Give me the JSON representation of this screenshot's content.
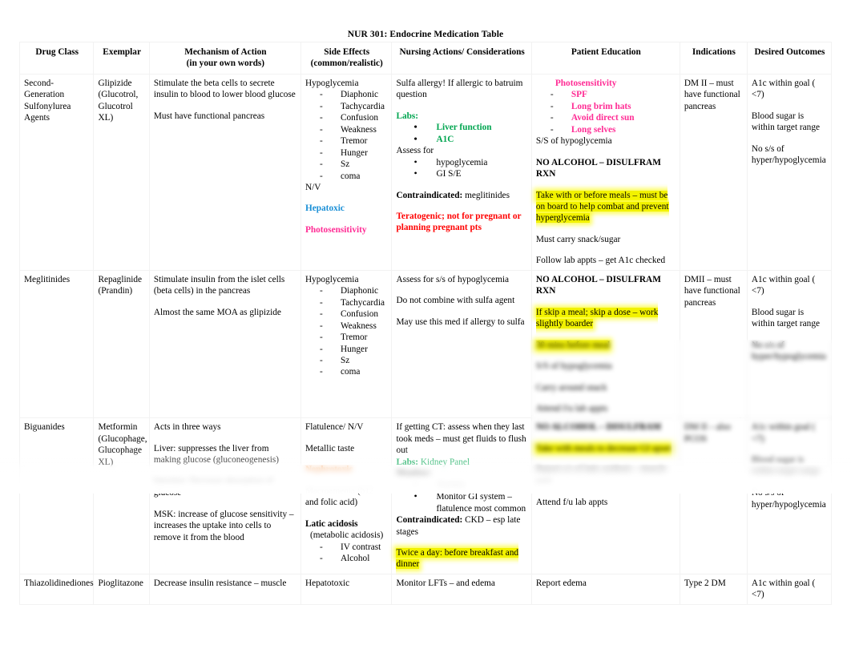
{
  "document": {
    "title": "NUR 301: Endocrine Medication Table"
  },
  "colors": {
    "green": "#00a550",
    "pink": "#ff2d95",
    "blue": "#1a8fd6",
    "red": "#ff0000",
    "orange": "#f07c20",
    "highlight": "#f2f200"
  },
  "table": {
    "headers": [
      {
        "line1": "Drug Class",
        "line2": ""
      },
      {
        "line1": "Exemplar",
        "line2": ""
      },
      {
        "line1": "Mechanism of Action",
        "line2": "(in your own words)"
      },
      {
        "line1": "Side Effects",
        "line2": "(common/realistic)"
      },
      {
        "line1": "Nursing Actions/ Considerations",
        "line2": ""
      },
      {
        "line1": "Patient Education",
        "line2": ""
      },
      {
        "line1": "Indications",
        "line2": ""
      },
      {
        "line1": "Desired Outcomes",
        "line2": ""
      }
    ],
    "rows": [
      {
        "drug_class": "Second-Generation Sulfonylurea Agents",
        "exemplar": "Glipizide (Glucotrol, Glucotrol XL)",
        "moa": {
          "p1": "Stimulate the beta cells to secrete insulin to blood to lower blood glucose",
          "p2": "Must have functional pancreas"
        },
        "side_effects": {
          "heading": "Hypoglycemia",
          "items": [
            "Diaphonic",
            "Tachycardia",
            "Confusion",
            "Weakness",
            "Tremor",
            "Hunger",
            "Sz",
            "coma"
          ],
          "nv": "N/V",
          "hepatotoxic": "Hepatoxic",
          "photosensitivity": "Photosensitivity"
        },
        "nursing": {
          "p1": "Sulfa allergy! If allergic to batruim question",
          "labs_label": "Labs:",
          "labs": [
            "Liver function",
            "A1C"
          ],
          "assess_label": "Assess for",
          "assess": [
            "hypoglycemia",
            "GI S/E"
          ],
          "contraindicated_label": "Contraindicated:",
          "contraindicated_value": "meglitinides",
          "teratogenic": "Teratogenic; not for pregnant or planning pregnant pts"
        },
        "education": {
          "photo_heading": "Photosensitivity",
          "photo_items": [
            "SPF",
            "Long brim hats",
            "Avoid direct sun",
            "Long selves"
          ],
          "ss": "S/S of hypoglycemia",
          "no_alcohol": "NO ALCOHOL – DISULFRAM RXN",
          "highlight": "Take with or before meals – must be on board to help combat and prevent hyperglycemia",
          "snack": "Must carry snack/sugar",
          "labs": "Follow lab appts – get A1c checked"
        },
        "indications": "DM II – must have functional pancreas",
        "outcomes": [
          "A1c within goal ( <7)",
          "Blood sugar is within target range",
          "No s/s of hyper/hypoglycemia"
        ]
      },
      {
        "drug_class": "Meglitinides",
        "exemplar": "Repaglinide (Prandin)",
        "moa": {
          "p1": "Stimulate insulin from the islet cells (beta cells) in the pancreas",
          "p2": "Almost the same MOA as glipizide"
        },
        "side_effects": {
          "heading": "Hypoglycemia",
          "items": [
            "Diaphonic",
            "Tachycardia",
            "Confusion",
            "Weakness",
            "Tremor",
            "Hunger",
            "Sz",
            "coma"
          ]
        },
        "nursing": {
          "p1": "Assess for s/s of hypoglycemia",
          "p2": "Do not combine with sulfa agent",
          "p3": "May use this med if allergy to sulfa"
        },
        "education": {
          "no_alcohol": "NO ALCOHOL – DISULFRAM RXN",
          "highlight1": "If skip a meal; skip a dose – work slightly boarder",
          "highlight2": "30 mins before meal",
          "ss": "S/S of hypoglycemia",
          "snack": "Carry around snack",
          "labs": "Attend f/u lab appts"
        },
        "indications": "DMII – must have functional pancreas",
        "outcomes": [
          "A1c within goal ( <7)",
          "Blood sugar is within target range",
          "No s/s of hyper/hypoglycemia"
        ]
      },
      {
        "drug_class": "Biguanides",
        "exemplar": "Metformin (Glucophage, Glucophage XL)",
        "moa": {
          "p1": "Acts in three ways",
          "p2": "Liver: suppresses the liver from making glucose (gluconeogenesis)",
          "p3": "Intestine: Decrease absorption of glucose",
          "p4": "MSK: increase of glucose sensitivity – increases the uptake into cells to remove it from the blood"
        },
        "side_effects": {
          "flatulence": "Flatulence/ N/V",
          "metallic": "Metallic taste",
          "nephrotoxic": "Nephrotoxic",
          "macro": "Macroamenia (b12 and folic acid)",
          "latic_label": "Latic acidosis",
          "latic_sub": "(metabolic acidosis)",
          "latic_items": [
            "IV contrast",
            "Alcohol"
          ]
        },
        "nursing": {
          "p1": "If getting CT: assess when they last took meds – must get fluids to flush out",
          "labs_label": "Labs:",
          "labs_value": "Kidney Panel",
          "monitor_label": "Monitor:",
          "monitor": [
            "Anemia",
            "Monitor GI system – flatulence most common"
          ],
          "contraindicated_label": "Contraindicated:",
          "contraindicated_value": "CKD – esp late stages",
          "highlight": "Twice a day: before breakfast and dinner"
        },
        "education": {
          "line1": "NO ALCOHOL – DISULFRAM",
          "highlight": "Take with meals to decrease GI upset",
          "line2": "Report s/s of latic acidosis – muscle pain",
          "line3": "Attend f/u lab appts"
        },
        "indications": "DM II – also PCOS",
        "outcomes": [
          "A1c within goal ( <7)",
          "Blood sugar is within target range",
          "No s/s of hyper/hypoglycemia"
        ]
      },
      {
        "drug_class": "Thiazolidinediones",
        "exemplar": "Pioglitazone",
        "moa": {
          "p1": "Decrease insulin resistance – muscle"
        },
        "side_effects": {
          "flatulence": "Hepatotoxic"
        },
        "nursing": {
          "p1": "Monitor LFTs – and edema"
        },
        "education": {
          "line1": "Report edema"
        },
        "indications": "Type 2 DM",
        "outcomes": [
          "A1c within goal ( <7)"
        ]
      }
    ]
  }
}
